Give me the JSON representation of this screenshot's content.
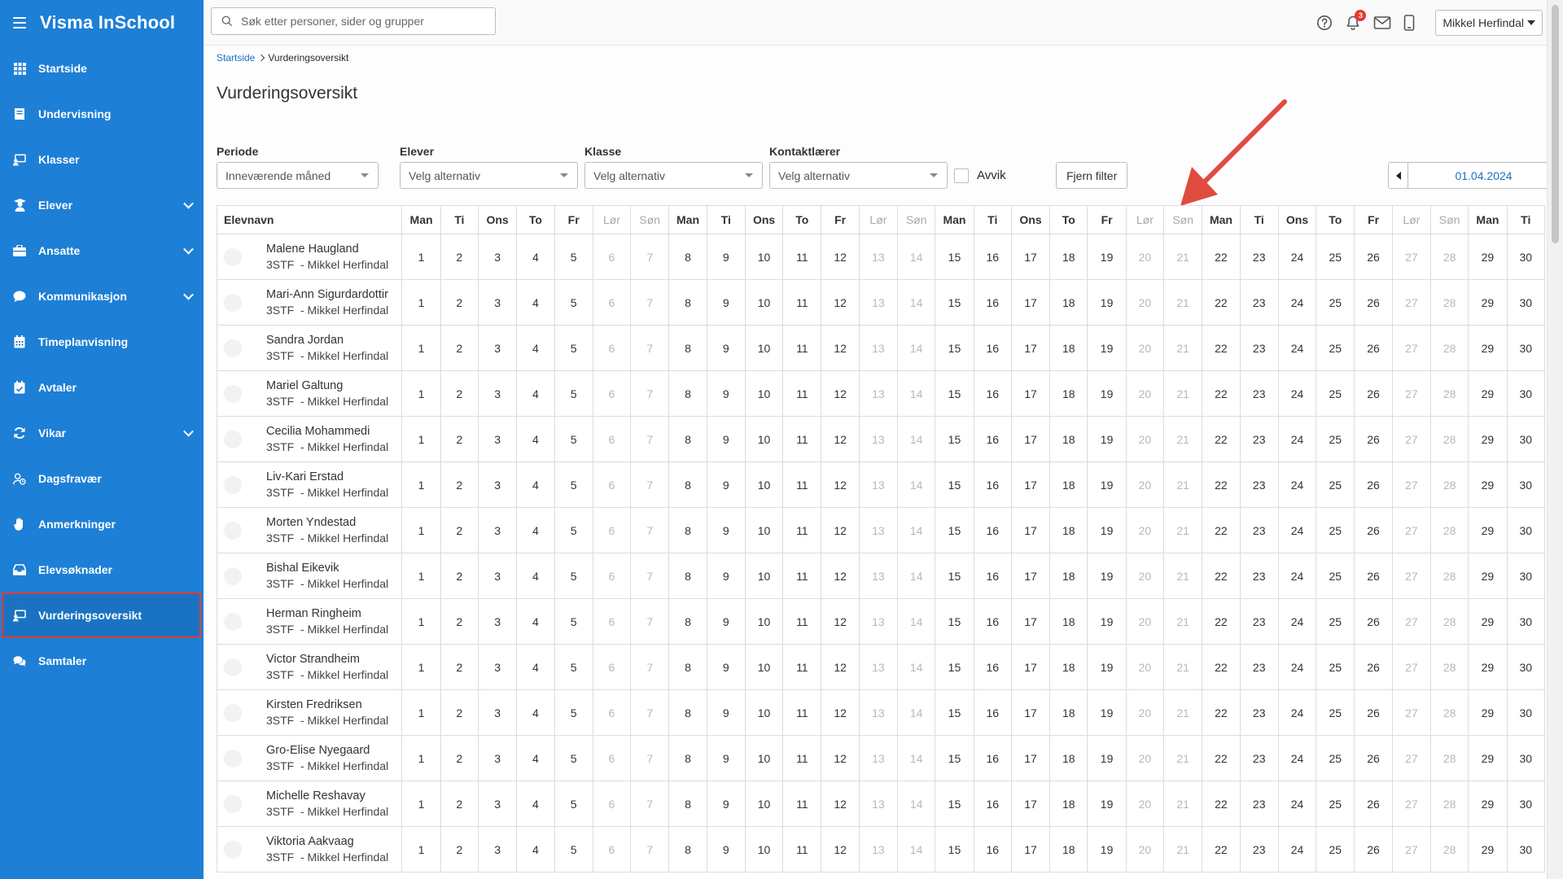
{
  "app": {
    "title": "Visma InSchool"
  },
  "sidebar": {
    "items": [
      {
        "label": "Startside",
        "icon": "grid-icon",
        "expandable": false
      },
      {
        "label": "Undervisning",
        "icon": "book-icon",
        "expandable": false
      },
      {
        "label": "Klasser",
        "icon": "classroom-icon",
        "expandable": false
      },
      {
        "label": "Elever",
        "icon": "student-icon",
        "expandable": true
      },
      {
        "label": "Ansatte",
        "icon": "briefcase-icon",
        "expandable": true
      },
      {
        "label": "Kommunikasjon",
        "icon": "chat-icon",
        "expandable": true
      },
      {
        "label": "Timeplanvisning",
        "icon": "calendar-icon",
        "expandable": false
      },
      {
        "label": "Avtaler",
        "icon": "calendar-check-icon",
        "expandable": false
      },
      {
        "label": "Vikar",
        "icon": "sync-icon",
        "expandable": true
      },
      {
        "label": "Dagsfravær",
        "icon": "user-clock-icon",
        "expandable": false
      },
      {
        "label": "Anmerkninger",
        "icon": "hand-icon",
        "expandable": false
      },
      {
        "label": "Elevsøknader",
        "icon": "inbox-icon",
        "expandable": false
      },
      {
        "label": "Vurderingsoversikt",
        "icon": "classroom-icon",
        "expandable": false,
        "active": true
      },
      {
        "label": "Samtaler",
        "icon": "chats-icon",
        "expandable": false
      }
    ]
  },
  "header": {
    "search_placeholder": "Søk etter personer, sider og grupper",
    "notification_count": "3",
    "user_name": "Mikkel Herfindal"
  },
  "breadcrumb": {
    "home": "Startside",
    "current": "Vurderingsoversikt"
  },
  "page": {
    "title": "Vurderingsoversikt"
  },
  "filters": {
    "periode": {
      "label": "Periode",
      "value": "Inneværende måned"
    },
    "elever": {
      "label": "Elever",
      "value": "Velg alternativ"
    },
    "klasse": {
      "label": "Klasse",
      "value": "Velg alternativ"
    },
    "kontaktlaerer": {
      "label": "Kontaktlærer",
      "value": "Velg alternativ"
    },
    "avvik_label": "Avvik",
    "avvik_checked": false,
    "clear_label": "Fjern filter",
    "date": "01.04.2024"
  },
  "table": {
    "name_header": "Elevnavn",
    "days": [
      {
        "label": "Man",
        "num": "1",
        "weekend": false
      },
      {
        "label": "Ti",
        "num": "2",
        "weekend": false
      },
      {
        "label": "Ons",
        "num": "3",
        "weekend": false
      },
      {
        "label": "To",
        "num": "4",
        "weekend": false
      },
      {
        "label": "Fr",
        "num": "5",
        "weekend": false
      },
      {
        "label": "Lør",
        "num": "6",
        "weekend": true
      },
      {
        "label": "Søn",
        "num": "7",
        "weekend": true
      },
      {
        "label": "Man",
        "num": "8",
        "weekend": false
      },
      {
        "label": "Ti",
        "num": "9",
        "weekend": false
      },
      {
        "label": "Ons",
        "num": "10",
        "weekend": false
      },
      {
        "label": "To",
        "num": "11",
        "weekend": false
      },
      {
        "label": "Fr",
        "num": "12",
        "weekend": false
      },
      {
        "label": "Lør",
        "num": "13",
        "weekend": true
      },
      {
        "label": "Søn",
        "num": "14",
        "weekend": true
      },
      {
        "label": "Man",
        "num": "15",
        "weekend": false
      },
      {
        "label": "Ti",
        "num": "16",
        "weekend": false
      },
      {
        "label": "Ons",
        "num": "17",
        "weekend": false
      },
      {
        "label": "To",
        "num": "18",
        "weekend": false
      },
      {
        "label": "Fr",
        "num": "19",
        "weekend": false
      },
      {
        "label": "Lør",
        "num": "20",
        "weekend": true
      },
      {
        "label": "Søn",
        "num": "21",
        "weekend": true
      },
      {
        "label": "Man",
        "num": "22",
        "weekend": false
      },
      {
        "label": "Ti",
        "num": "23",
        "weekend": false
      },
      {
        "label": "Ons",
        "num": "24",
        "weekend": false
      },
      {
        "label": "To",
        "num": "25",
        "weekend": false
      },
      {
        "label": "Fr",
        "num": "26",
        "weekend": false
      },
      {
        "label": "Lør",
        "num": "27",
        "weekend": true
      },
      {
        "label": "Søn",
        "num": "28",
        "weekend": true
      },
      {
        "label": "Man",
        "num": "29",
        "weekend": false
      },
      {
        "label": "Ti",
        "num": "30",
        "weekend": false
      }
    ],
    "students": [
      {
        "name": "Malene Haugland",
        "class": "3STF  - Mikkel Herfindal"
      },
      {
        "name": "Mari-Ann Sigurdardottir",
        "class": "3STF  - Mikkel Herfindal"
      },
      {
        "name": "Sandra Jordan",
        "class": "3STF  - Mikkel Herfindal"
      },
      {
        "name": "Mariel Galtung",
        "class": "3STF  - Mikkel Herfindal"
      },
      {
        "name": "Cecilia Mohammedi",
        "class": "3STF  - Mikkel Herfindal"
      },
      {
        "name": "Liv-Kari Erstad",
        "class": "3STF  - Mikkel Herfindal"
      },
      {
        "name": "Morten Yndestad",
        "class": "3STF  - Mikkel Herfindal"
      },
      {
        "name": "Bishal Eikevik",
        "class": "3STF  - Mikkel Herfindal"
      },
      {
        "name": "Herman Ringheim",
        "class": "3STF  - Mikkel Herfindal"
      },
      {
        "name": "Victor Strandheim",
        "class": "3STF  - Mikkel Herfindal"
      },
      {
        "name": "Kirsten Fredriksen",
        "class": "3STF  - Mikkel Herfindal"
      },
      {
        "name": "Gro-Elise Nyegaard",
        "class": "3STF  - Mikkel Herfindal"
      },
      {
        "name": "Michelle Reshavay",
        "class": "3STF  - Mikkel Herfindal"
      },
      {
        "name": "Viktoria Aakvaag",
        "class": "3STF  - Mikkel Herfindal"
      }
    ]
  },
  "colors": {
    "sidebar_bg": "#1d7fd6",
    "active_outline": "#e53935",
    "link": "#1d6fbf",
    "annotation_arrow": "#e04b3f"
  }
}
